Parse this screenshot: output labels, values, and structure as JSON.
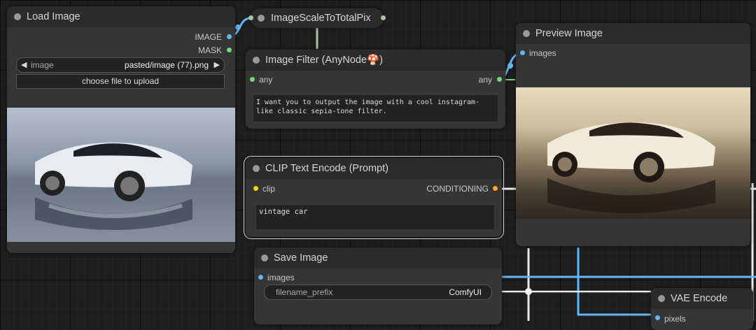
{
  "load_image": {
    "title": "Load Image",
    "outputs": [
      "IMAGE",
      "MASK"
    ],
    "widget_name": "image",
    "widget_value": "pasted/image (77).png",
    "upload_label": "choose file to upload"
  },
  "scale_node": {
    "title": "ImageScaleToTotalPix"
  },
  "image_filter": {
    "title": "Image Filter (AnyNode",
    "title_emoji": "🍄",
    "title_suffix": ")",
    "input": "any",
    "output": "any",
    "prompt": "I want you to output the image with a cool instagram-like classic sepia-tone filter."
  },
  "clip": {
    "title": "CLIP Text Encode (Prompt)",
    "input": "clip",
    "output": "CONDITIONING",
    "text": "vintage car"
  },
  "preview": {
    "title": "Preview Image",
    "input": "images"
  },
  "save": {
    "title": "Save Image",
    "input": "images",
    "widget_name": "filename_prefix",
    "widget_value": "ComfyUI"
  },
  "vae": {
    "title": "VAE Encode",
    "input": "pixels"
  },
  "colors": {
    "image_link": "#64b5f6",
    "link_white": "#e8e8e8",
    "any_link": "#7bd67b",
    "node_bg": "#353535",
    "node_title": "#2b2b2b"
  }
}
